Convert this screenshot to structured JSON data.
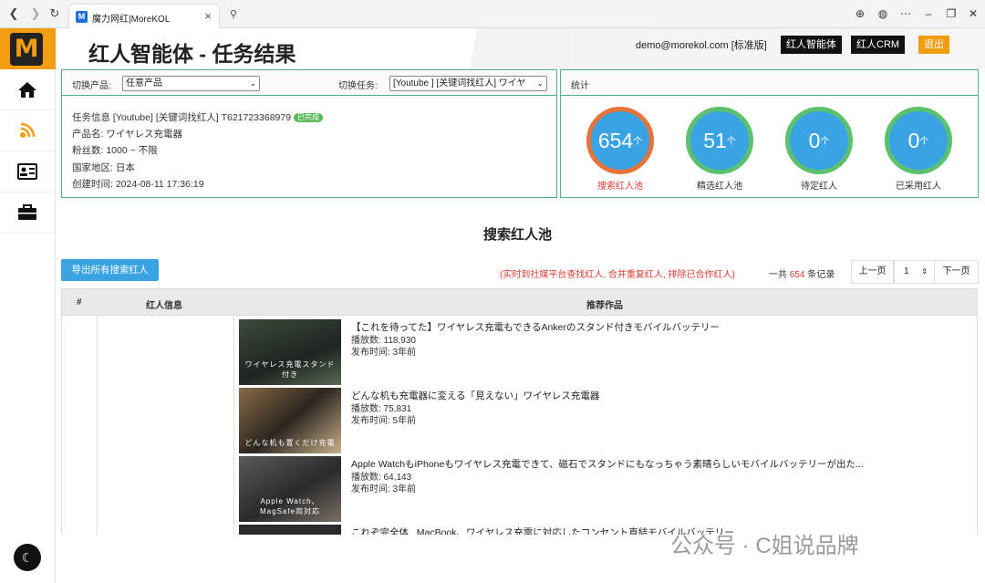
{
  "browser": {
    "tab_title": "魔力网红|MoreKOL",
    "tab_favicon": "M"
  },
  "sidebar": {
    "logo": "M",
    "items": [
      "home-icon",
      "rss-icon",
      "id-card-icon",
      "briefcase-icon"
    ]
  },
  "header": {
    "title": "红人智能体 - 任务结果",
    "email": "demo@morekol.com [标准版]",
    "btn_agent": "红人智能体",
    "btn_crm": "红人CRM",
    "btn_logout": "退出"
  },
  "task_panel": {
    "product_label": "切换产品:",
    "product_value": "任意产品",
    "task_label": "切换任务:",
    "task_value": "[Youtube ] [关键词找红人] ワイヤ",
    "info_line": "任务信息 [Youtube] [关键词找红人] T621723368979",
    "status_badge": "已完成",
    "product_name": "产品名: ワイヤレス充電器",
    "followers": "粉丝数: 1000 ~ 不限",
    "region": "国家地区: 日本",
    "created": "创建时间: 2024-08-11 17:36:19"
  },
  "stats_panel": {
    "title": "统计",
    "items": [
      {
        "value": "654",
        "label": "搜索红人池"
      },
      {
        "value": "51",
        "label": "精选红人池"
      },
      {
        "value": "0",
        "label": "待定红人"
      },
      {
        "value": "0",
        "label": "已采用红人"
      }
    ],
    "arrow": "个"
  },
  "pool": {
    "section_title": "搜索红人池",
    "export_label": "导出所有搜索红人",
    "realtime_note": "(实时到社媒平台查找红人, 合并重复红人, 排除已合作红人)",
    "total_prefix": "一共",
    "total_count": "654",
    "total_suffix": "条记录",
    "prev": "上一页",
    "page": "1",
    "next": "下一页",
    "col_index": "#",
    "col_info": "红人信息",
    "col_works": "推荐作品"
  },
  "works": [
    {
      "title": "【これを待ってた】ワイヤレス充電もできるAnkerのスタンド付きモバイルバッテリー",
      "views": "播放数: 118,930",
      "time": "发布时间: 3年前",
      "thumb_text": "ワイヤレス充電スタンド付き"
    },
    {
      "title": "どんな机も充電器に変える「見えない」ワイヤレス充電器",
      "views": "播放数: 75,831",
      "time": "发布时间: 5年前",
      "thumb_text": "どんな机も置くだけ充電"
    },
    {
      "title": "Apple WatchもiPhoneもワイヤレス充電できて、磁石でスタンドにもなっちゃう素晴らしいモバイルバッテリーが出た...",
      "views": "播放数: 64,143",
      "time": "发布时间: 3年前",
      "thumb_text": "Apple Watch、MagSafe両対応"
    },
    {
      "title": "これぞ完全体...MacBook、ワイヤレス充電に対応したコンセント直結モバイルバッテリー",
      "views": "",
      "time": "",
      "thumb_text": ""
    }
  ],
  "watermark": "公众号 · C姐说品牌"
}
